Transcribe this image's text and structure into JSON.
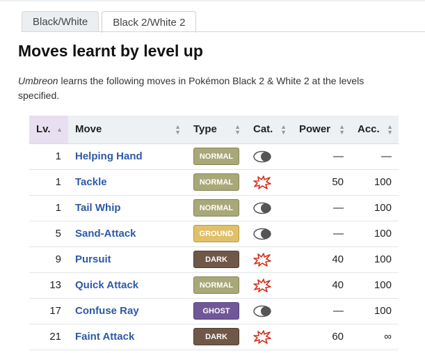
{
  "tabs": [
    {
      "label": "Black/White",
      "active": false
    },
    {
      "label": "Black 2/White 2",
      "active": true
    }
  ],
  "heading": "Moves learnt by level up",
  "intro": {
    "pokemon": "Umbreon",
    "text": " learns the following moves in Pokémon Black 2 & White 2 at the levels specified."
  },
  "table": {
    "headers": {
      "lv": "Lv.",
      "move": "Move",
      "type": "Type",
      "cat": "Cat.",
      "power": "Power",
      "acc": "Acc."
    },
    "rows": [
      {
        "lv": "1",
        "move": "Helping Hand",
        "type": "NORMAL",
        "cat": "status",
        "power": "—",
        "acc": "—"
      },
      {
        "lv": "1",
        "move": "Tackle",
        "type": "NORMAL",
        "cat": "physical",
        "power": "50",
        "acc": "100"
      },
      {
        "lv": "1",
        "move": "Tail Whip",
        "type": "NORMAL",
        "cat": "status",
        "power": "—",
        "acc": "100"
      },
      {
        "lv": "5",
        "move": "Sand-Attack",
        "type": "GROUND",
        "cat": "status",
        "power": "—",
        "acc": "100"
      },
      {
        "lv": "9",
        "move": "Pursuit",
        "type": "DARK",
        "cat": "physical",
        "power": "40",
        "acc": "100"
      },
      {
        "lv": "13",
        "move": "Quick Attack",
        "type": "NORMAL",
        "cat": "physical",
        "power": "40",
        "acc": "100"
      },
      {
        "lv": "17",
        "move": "Confuse Ray",
        "type": "GHOST",
        "cat": "status",
        "power": "—",
        "acc": "100"
      },
      {
        "lv": "21",
        "move": "Faint Attack",
        "type": "DARK",
        "cat": "physical",
        "power": "60",
        "acc": "∞"
      }
    ]
  },
  "type_colors": {
    "NORMAL": "#a8a878",
    "GROUND": "#e0c068",
    "DARK": "#705848",
    "GHOST": "#705898"
  }
}
